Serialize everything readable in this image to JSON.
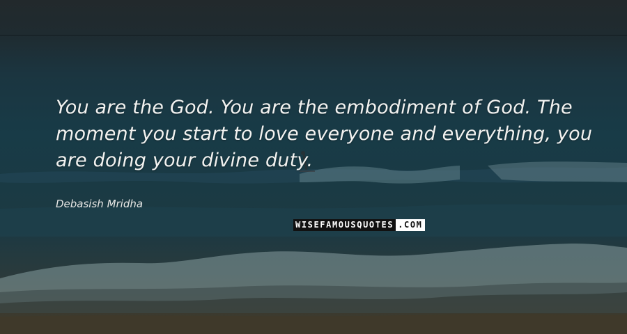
{
  "quote": {
    "text": "You are the God. You are the embodiment of God. The moment you start to love everyone and everything, you are doing your divine duty.",
    "author": "Debasish Mridha"
  },
  "watermark": {
    "left_text": "WISEFAMOUSQUOTES",
    "right_text": ".COM"
  }
}
